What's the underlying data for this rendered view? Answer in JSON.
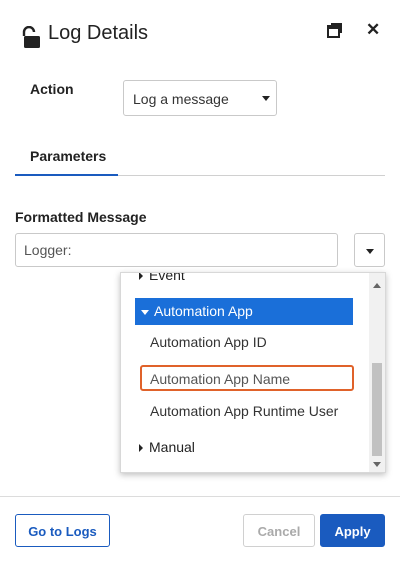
{
  "header": {
    "title": "Log Details",
    "icons": {
      "lock": "unlock-icon",
      "restore": "restore-window-icon",
      "close": "close-icon"
    },
    "close_glyph": "✕"
  },
  "action": {
    "label": "Action",
    "selected": "Log a message"
  },
  "tabs": [
    {
      "label": "Parameters",
      "active": true
    }
  ],
  "formatted_message": {
    "label": "Formatted Message",
    "value": "Logger:"
  },
  "dropdown": {
    "items": {
      "event": "Event",
      "automation_app": "Automation App",
      "app_id": "Automation App ID",
      "app_name": "Automation App Name",
      "runtime_user": "Automation App Runtime User",
      "manual": "Manual"
    },
    "expanded_group": "Automation App",
    "highlighted_item": "Automation App Name"
  },
  "footer": {
    "go_to_logs": "Go to Logs",
    "cancel": "Cancel",
    "apply": "Apply"
  },
  "colors": {
    "accent": "#1a5bbf",
    "selected_bg": "#1a6fd9",
    "highlight_border": "#e0622a"
  }
}
